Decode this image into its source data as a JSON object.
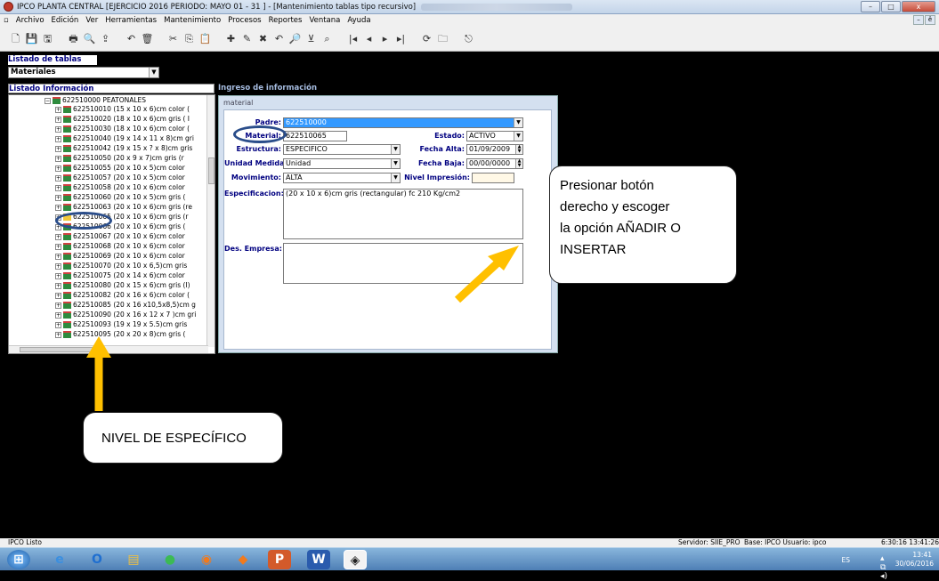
{
  "window": {
    "title": "IPCO PLANTA CENTRAL [EJERCICIO 2016 PERIODO: MAYO 01 - 31 ] - [Mantenimiento tablas tipo recursivo]",
    "controls": [
      "–",
      "□",
      "x"
    ]
  },
  "menu": [
    "Archivo",
    "Edición",
    "Ver",
    "Herramientas",
    "Mantenimiento",
    "Procesos",
    "Reportes",
    "Ventana",
    "Ayuda"
  ],
  "mdi_controls": [
    "–",
    "ê"
  ],
  "toolbar": {
    "icons": [
      "new-doc-icon",
      "save-icon",
      "save-as-icon",
      "print-icon",
      "preview-icon",
      "export-icon",
      "back-icon",
      "delete-icon",
      "cut-icon",
      "copy-icon",
      "paste-icon",
      "add-icon",
      "edit-icon",
      "cancel-icon",
      "undo-icon",
      "search-icon",
      "filter-icon",
      "binoculars-icon",
      "first-icon",
      "prev-icon",
      "next-icon",
      "last-icon",
      "refresh-icon",
      "folder-icon",
      "exit-icon"
    ],
    "glyphs": [
      "🗋",
      "💾",
      "🖫",
      "🖶",
      "🔍",
      "⇪",
      "↶",
      "🗑",
      "✂",
      "⎘",
      "📋",
      "✚",
      "✎",
      "✖",
      "↶",
      "🔎",
      "⊻",
      "⌕",
      "|◂",
      "◂",
      "▸",
      "▸|",
      "⟳",
      "🗀",
      "⎋"
    ]
  },
  "left_panel": {
    "tables_header": "Listado de tablas",
    "tables_selected": "Materiales",
    "info_header": "Listado Información"
  },
  "tree": {
    "root": "622510000 PEATONALES",
    "items": [
      "622510010 (15 x 10 x 6)cm  color (",
      "622510020 (18 x 10 x 6)cm  gris ( I",
      "622510030 (18 x 10 x 6)cm  color (",
      "622510040 (19 x 14 x 11 x 8)cm  gri",
      "622510042 (19 x 15 x ? x 8)cm  gris",
      "622510050 (20 x 9 x 7)cm  gris (r",
      "622510055 (20 x 10 x 5)cm  color",
      "622510057 (20 x 10 x 5)cm  color",
      "622510058 (20 x 10 x 6)cm  color",
      "622510060 (20 x 10 x 5)cm  gris (",
      "622510063 (20 x 10 x 6)cm gris (re",
      "622510065 (20 x 10 x 6)cm  gris (r",
      "622510066 (20 x 10 x 6)cm  gris (",
      "622510067 (20 x 10 x 6)cm  color",
      "622510068 (20 x 10 x 6)cm  color",
      "622510069 (20 x 10 x 6)cm  color",
      "622510070 (20 x 10 x 6,5)cm  gris",
      "622510075 (20 x 14 x 6)cm  color",
      "622510080 (20 x 15 x 6)cm gris (I)",
      "622510082 (20 x 16 x  6)cm color (",
      "622510085 (20 x 16 x10,5x8,5)cm g",
      "622510090 (20 x 16 x 12 x 7 )cm gri",
      "622510093 (19 x 19 x 5.5)cm  gris",
      "622510095 (20 x 20 x 8)cm  gris ("
    ]
  },
  "form": {
    "header": "Ingreso de información",
    "group": "material",
    "padre_label": "Padre:",
    "padre_value": "622510000",
    "material_label": "Material:",
    "material_value": "622510065",
    "estado_label": "Estado:",
    "estado_value": "ACTIVO",
    "estructura_label": "Estructura:",
    "estructura_value": "ESPECIFICO",
    "fecha_alta_label": "Fecha Alta:",
    "fecha_alta_value": "01/09/2009",
    "unidad_label": "Unidad Medida:",
    "unidad_value": "Unidad",
    "fecha_baja_label": "Fecha Baja:",
    "fecha_baja_value": "00/00/0000",
    "movimiento_label": "Movimiento:",
    "movimiento_value": "ALTA",
    "nivel_label": "Nivel Impresión:",
    "nivel_value": "",
    "especificacion_label": "Especificacion:",
    "especificacion_value": "(20 x 10 x  6)cm  gris (rectangular)  fc 210 Kg/cm2",
    "des_empresa_label": "Des. Empresa:",
    "des_empresa_value": ""
  },
  "annotations": {
    "right_callout": [
      "Presionar botón",
      "derecho y escoger",
      "la opción AÑADIR O",
      "INSERTAR"
    ],
    "bottom_callout": "NIVEL DE ESPECÍFICO",
    "arrow_color": "#ffc000",
    "ellipse_color": "#2a4d8a"
  },
  "status": {
    "left": "IPCO Listo",
    "servidor": "Servidor: SIIE_PRO",
    "base": "Base: IPCO Usuario: ipco",
    "datetime": "6:30:16 13:41:26"
  },
  "taskbar": {
    "apps": [
      "start-orb",
      "ie-icon",
      "outlook-icon",
      "explorer-icon",
      "chrome-icon",
      "firefox-icon",
      "firefox-alt-icon",
      "powerpoint-icon",
      "word-icon",
      "ipco-app-icon"
    ],
    "tray_lang": "ES",
    "tray_time": "13:41",
    "tray_date": "30/06/2016"
  }
}
